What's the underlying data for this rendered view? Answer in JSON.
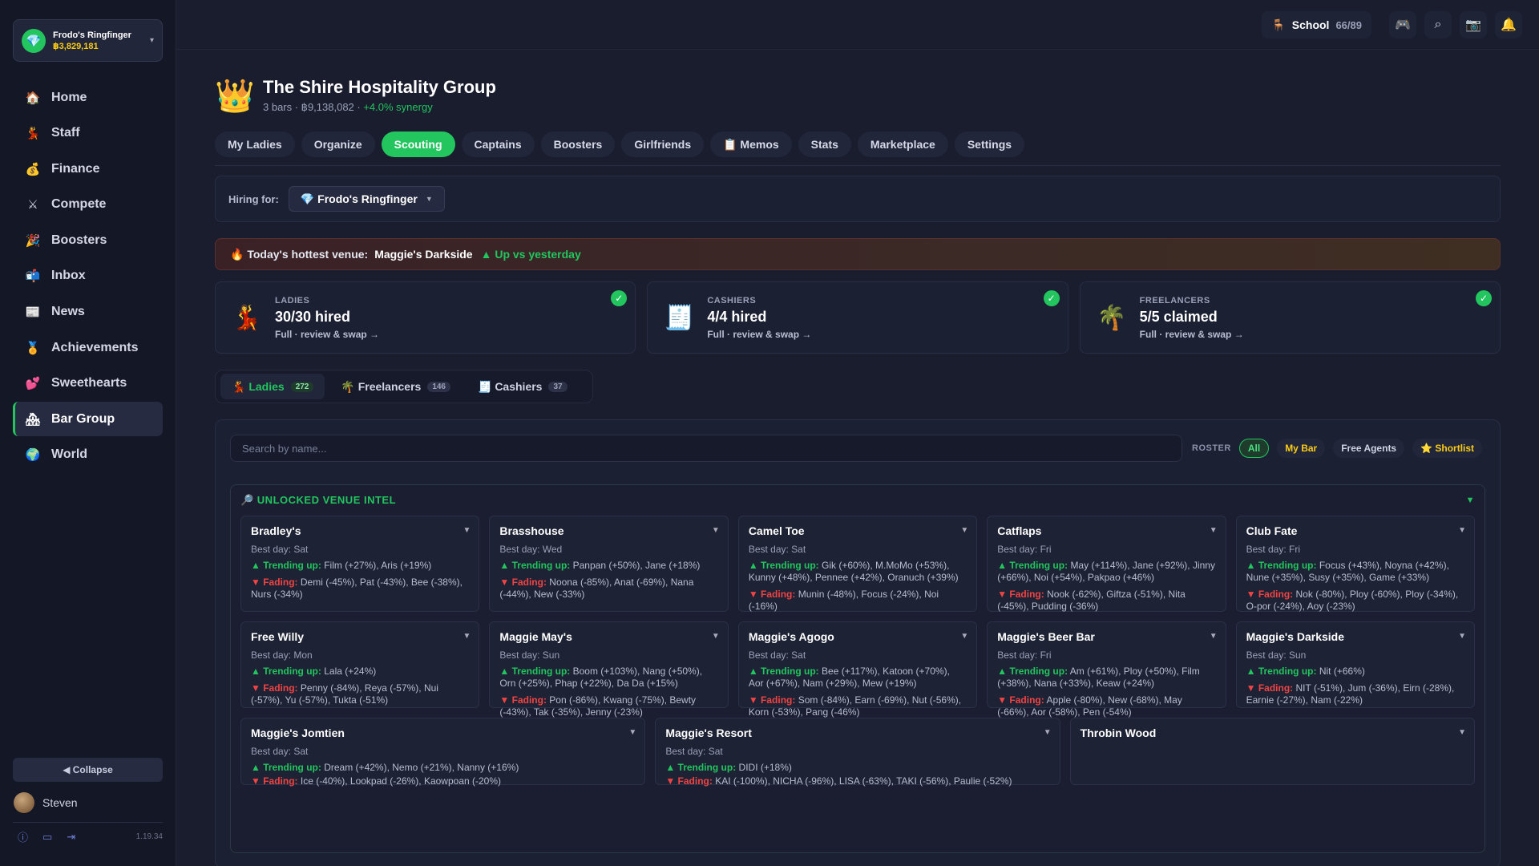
{
  "account": {
    "name": "Frodo's Ringfinger",
    "balance": "฿3,829,181"
  },
  "nav": [
    {
      "label": "Home",
      "icon": "🏠"
    },
    {
      "label": "Staff",
      "icon": "💃"
    },
    {
      "label": "Finance",
      "icon": "💰"
    },
    {
      "label": "Compete",
      "icon": "⚔"
    },
    {
      "label": "Boosters",
      "icon": "🎉"
    },
    {
      "label": "Inbox",
      "icon": "📬"
    },
    {
      "label": "News",
      "icon": "📰"
    },
    {
      "label": "Achievements",
      "icon": "🏅"
    },
    {
      "label": "Sweethearts",
      "icon": "💕"
    },
    {
      "label": "Bar Group",
      "icon": "🏘"
    },
    {
      "label": "World",
      "icon": "🌍"
    }
  ],
  "sidebar_footer": {
    "collapse": "◀ Collapse",
    "user": "Steven",
    "version": "1.19.34"
  },
  "topbar": {
    "school_label": "School",
    "school_count": "66/89"
  },
  "group": {
    "title": "The Shire Hospitality Group",
    "subtitle": "3 bars · ฿9,138,082 · ",
    "synergy": "+4.0% synergy"
  },
  "tabs": [
    "My Ladies",
    "Organize",
    "Scouting",
    "Captains",
    "Boosters",
    "Girlfriends",
    "📋 Memos",
    "Stats",
    "Marketplace",
    "Settings"
  ],
  "hiring": {
    "label": "Hiring for:",
    "value": "💎 Frodo's Ringfinger"
  },
  "hot": {
    "prefix": "🔥 Today's hottest venue:",
    "venue": "Maggie's Darkside",
    "trend": "▲ Up vs yesterday"
  },
  "cards": [
    {
      "icon": "💃",
      "caption": "LADIES",
      "value": "30/30 hired",
      "link": "Full · review & swap →"
    },
    {
      "icon": "🧾",
      "caption": "CASHIERS",
      "value": "4/4 hired",
      "link": "Full · review & swap →"
    },
    {
      "icon": "🌴",
      "caption": "FREELANCERS",
      "value": "5/5 claimed",
      "link": "Full · review & swap →"
    }
  ],
  "subtabs": [
    {
      "label": "💃 Ladies",
      "count": "272"
    },
    {
      "label": "🌴 Freelancers",
      "count": "146"
    },
    {
      "label": "🧾 Cashiers",
      "count": "37"
    }
  ],
  "search": {
    "placeholder": "Search by name..."
  },
  "roster": {
    "label": "ROSTER",
    "filters": [
      "All",
      "My Bar",
      "Free Agents",
      "⭐ Shortlist"
    ]
  },
  "intel": {
    "title": "🔎 UNLOCKED VENUE INTEL",
    "trending_label": "▲ Trending up:",
    "fading_label": "▼ Fading:",
    "venues": [
      {
        "name": "Bradley's",
        "best": "Best day: Sat",
        "up": "Film (+27%), Aris (+19%)",
        "down": "Demi (-45%), Pat (-43%), Bee (-38%), Nurs (-34%)"
      },
      {
        "name": "Brasshouse",
        "best": "Best day: Wed",
        "up": "Panpan (+50%), Jane (+18%)",
        "down": "Noona (-85%), Anat (-69%), Nana (-44%), New (-33%)"
      },
      {
        "name": "Camel Toe",
        "best": "Best day: Sat",
        "up": "Gik (+60%), M.MoMo (+53%), Kunny (+48%), Pennee (+42%), Oranuch (+39%)",
        "down": "Munin (-48%), Focus (-24%), Noi (-16%)"
      },
      {
        "name": "Catflaps",
        "best": "Best day: Fri",
        "up": "May (+114%), Jane (+92%), Jinny (+66%), Noi (+54%), Pakpao (+46%)",
        "down": "Nook (-62%), Giftza (-51%), Nita (-45%), Pudding (-36%)"
      },
      {
        "name": "Club Fate",
        "best": "Best day: Fri",
        "up": "Focus (+43%), Noyna (+42%), Nune (+35%), Susy (+35%), Game (+33%)",
        "down": "Nok (-80%), Ploy (-60%), Ploy (-34%), O-por (-24%), Aoy (-23%)"
      },
      {
        "name": "Free Willy",
        "best": "Best day: Mon",
        "up": "Lala (+24%)",
        "down": "Penny (-84%), Reya (-57%), Nui (-57%), Yu (-57%), Tukta (-51%)"
      },
      {
        "name": "Maggie May's",
        "best": "Best day: Sun",
        "up": "Boom (+103%), Nang (+50%), Orn (+25%), Phap (+22%), Da Da (+15%)",
        "down": "Pon (-86%), Kwang (-75%), Bewty (-43%), Tak (-35%), Jenny (-23%)"
      },
      {
        "name": "Maggie's Agogo",
        "best": "Best day: Sat",
        "up": "Bee (+117%), Katoon (+70%), Aor (+67%), Nam (+29%), Mew (+19%)",
        "down": "Som (-84%), Earn (-69%), Nut (-56%), Korn (-53%), Pang (-46%)"
      },
      {
        "name": "Maggie's Beer Bar",
        "best": "Best day: Fri",
        "up": "Am (+61%), Ploy (+50%), Film (+38%), Nana (+33%), Keaw (+24%)",
        "down": "Apple (-80%), New (-68%), May (-66%), Aor (-58%), Pen (-54%)"
      },
      {
        "name": "Maggie's Darkside",
        "best": "Best day: Sun",
        "up": "Nit (+66%)",
        "down": "NIT (-51%), Jum (-36%), Eirn (-28%), Earnie (-27%), Nam (-22%)"
      },
      {
        "name": "Maggie's Jomtien",
        "best": "Best day: Sat",
        "up": "Dream (+42%), Nemo (+21%), Nanny (+16%)",
        "down": "Ice (-40%), Lookpad (-26%), Kaowpoan (-20%)"
      },
      {
        "name": "Maggie's Resort",
        "best": "Best day: Sat",
        "up": "DIDI (+18%)",
        "down": "KAI (-100%), NICHA (-96%), LISA (-63%), TAKI (-56%), Paulie (-52%)"
      },
      {
        "name": "Throbin Wood"
      }
    ]
  }
}
